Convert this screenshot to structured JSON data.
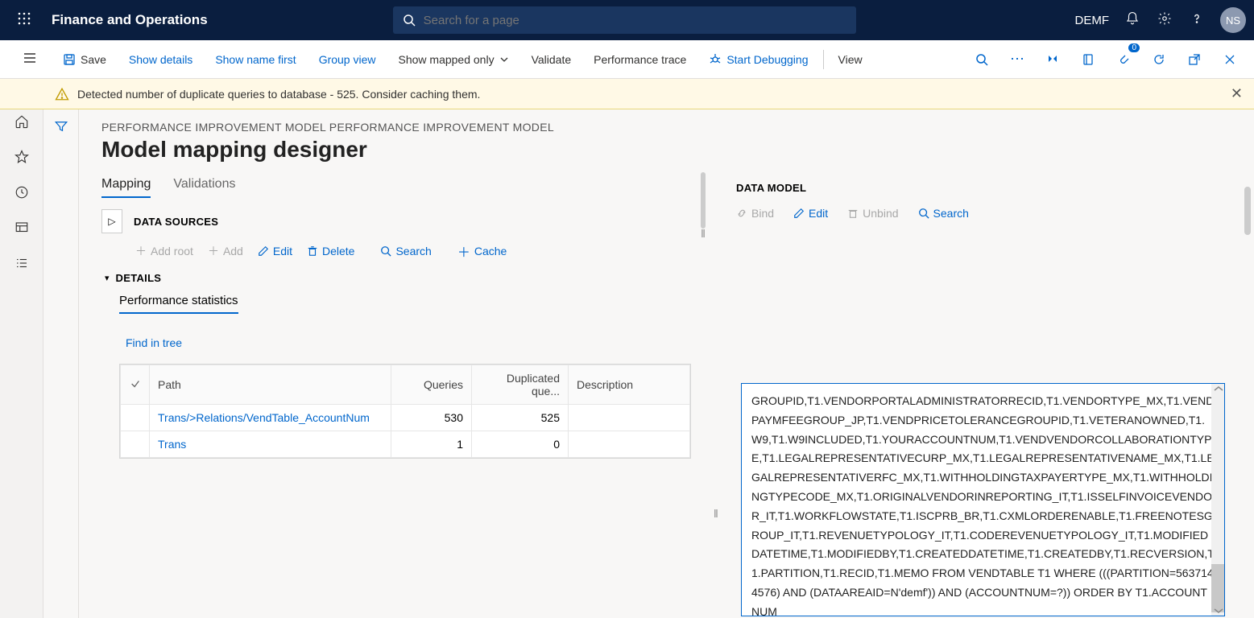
{
  "header": {
    "app_title": "Finance and Operations",
    "search_placeholder": "Search for a page",
    "company": "DEMF",
    "avatar": "NS"
  },
  "commandbar": {
    "save": "Save",
    "show_details": "Show details",
    "show_name_first": "Show name first",
    "group_view": "Group view",
    "show_mapped_only": "Show mapped only",
    "validate": "Validate",
    "performance_trace": "Performance trace",
    "start_debugging": "Start Debugging",
    "view": "View",
    "badge_count": "0"
  },
  "warning": {
    "text": "Detected number of duplicate queries to database - 525. Consider caching them."
  },
  "page": {
    "breadcrumb": "PERFORMANCE IMPROVEMENT MODEL PERFORMANCE IMPROVEMENT MODEL",
    "title": "Model mapping designer",
    "tabs": {
      "mapping": "Mapping",
      "validations": "Validations"
    },
    "data_sources_label": "DATA SOURCES",
    "actions": {
      "add_root": "Add root",
      "add": "Add",
      "edit": "Edit",
      "delete": "Delete",
      "search": "Search",
      "cache": "Cache"
    },
    "details_label": "DETAILS",
    "perf_stats_label": "Performance statistics",
    "find_in_tree": "Find in tree"
  },
  "grid": {
    "headers": {
      "path": "Path",
      "queries": "Queries",
      "dup": "Duplicated que...",
      "desc": "Description"
    },
    "rows": [
      {
        "path": "Trans/>Relations/VendTable_AccountNum",
        "q": "530",
        "d": "525",
        "desc": ""
      },
      {
        "path": "Trans",
        "q": "1",
        "d": "0",
        "desc": ""
      }
    ]
  },
  "datamodel": {
    "label": "DATA MODEL",
    "actions": {
      "bind": "Bind",
      "edit": "Edit",
      "unbind": "Unbind",
      "search": "Search"
    }
  },
  "sql": {
    "text": "GROUPID,T1.VENDORPORTALADMINISTRATORRECID,T1.VENDORTYPE_MX,T1.VENDPAYMFEEGROUP_JP,T1.VENDPRICETOLERANCEGROUPID,T1.VETERANOWNED,T1.W9,T1.W9INCLUDED,T1.YOURACCOUNTNUM,T1.VENDVENDORCOLLABORATIONTYPE,T1.LEGALREPRESENTATIVECURP_MX,T1.LEGALREPRESENTATIVENAME_MX,T1.LEGALREPRESENTATIVERFC_MX,T1.WITHHOLDINGTAXPAYERTYPE_MX,T1.WITHHOLDINGTYPECODE_MX,T1.ORIGINALVENDORINREPORTING_IT,T1.ISSELFINVOICEVENDOR_IT,T1.WORKFLOWSTATE,T1.ISCPRB_BR,T1.CXMLORDERENABLE,T1.FREENOTESGROUP_IT,T1.REVENUETYPOLOGY_IT,T1.CODEREVENUETYPOLOGY_IT,T1.MODIFIEDDATETIME,T1.MODIFIEDBY,T1.CREATEDDATETIME,T1.CREATEDBY,T1.RECVERSION,T1.PARTITION,T1.RECID,T1.MEMO FROM VENDTABLE T1 WHERE (((PARTITION=5637144576) AND (DATAAREAID=N'demf')) AND (ACCOUNTNUM=?)) ORDER BY T1.ACCOUNTNUM"
  }
}
